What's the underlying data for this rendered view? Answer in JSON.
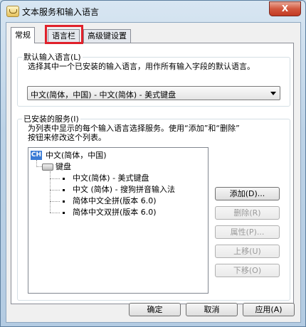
{
  "window": {
    "title": "文本服务和输入语言",
    "close_label": "X"
  },
  "tabs": [
    {
      "label": "常规",
      "active": true
    },
    {
      "label": "语言栏",
      "active": false,
      "highlighted": true
    },
    {
      "label": "高级键设置",
      "active": false
    }
  ],
  "default_language": {
    "heading": "默认输入语言(L)",
    "description": "选择其中一个已安装的输入语言，用作所有输入字段的默认语言。",
    "selected": "中文(简体，中国) - 中文(简体) - 美式键盘"
  },
  "installed_services": {
    "heading": "已安装的服务(I)",
    "description_line1": "为列表中显示的每个输入语言选择服务。使用“添加”和“删除”",
    "description_line2": "按钮来修改这个列表。",
    "tree": {
      "language_badge": "CH",
      "language": "中文(简体，中国)",
      "category": "键盘",
      "items": [
        "中文(简体) - 美式键盘",
        "中文 (简体) - 搜狗拼音输入法",
        "简体中文全拼(版本 6.0)",
        "简体中文双拼(版本 6.0)"
      ]
    },
    "buttons": {
      "add": "添加(D)...",
      "remove": "删除(R)",
      "properties": "属性(P)...",
      "move_up": "上移(U)",
      "move_down": "下移(O)"
    }
  },
  "footer": {
    "ok": "确定",
    "cancel": "取消",
    "apply": "应用(A)"
  },
  "colors": {
    "highlight_box": "#e0202a",
    "language_badge": "#3a7bd5"
  }
}
